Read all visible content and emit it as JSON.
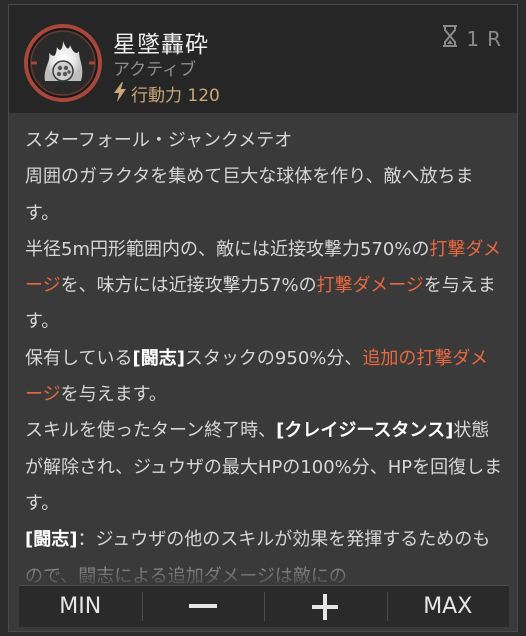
{
  "skill": {
    "name": "星墜轟砕",
    "type": "アクティブ",
    "ap_text": "行動力 120",
    "cooldown_value": "1",
    "cooldown_unit": "R"
  },
  "description": {
    "l1": "スターフォール・ジャンクメテオ",
    "l2": "周囲のガラクタを集めて巨大な球体を作り、敵へ放ちます。",
    "l3a": "半径5m円形範囲内の、敵には近接攻撃力570%の",
    "l3b": "打撃ダメージ",
    "l3c": "を、味方には近接攻撃力57%の",
    "l3d": "打撃ダメージ",
    "l3e": "を与えます。",
    "l4a": "保有している",
    "l4b": "[闘志]",
    "l4c": "スタックの950%分、",
    "l4d": "追加の打撃ダメージ",
    "l4e": "を与えます。",
    "l5a": "スキルを使ったターン終了時、",
    "l5b": "[クレイジースタンス]",
    "l5c": "状態が解除され、ジュウザの最大HPの100%分、HPを回復します。",
    "l6a": "[闘志]",
    "l6b": "：ジュウザの他のスキルが効果を発揮するためのもので、闘志による追加ダメージは敵にの"
  },
  "controls": {
    "min": "MIN",
    "decrease": "−",
    "increase": "+",
    "max": "MAX"
  },
  "colors": {
    "accent_red": "#e8693f",
    "ap_gold": "#c8a878"
  }
}
